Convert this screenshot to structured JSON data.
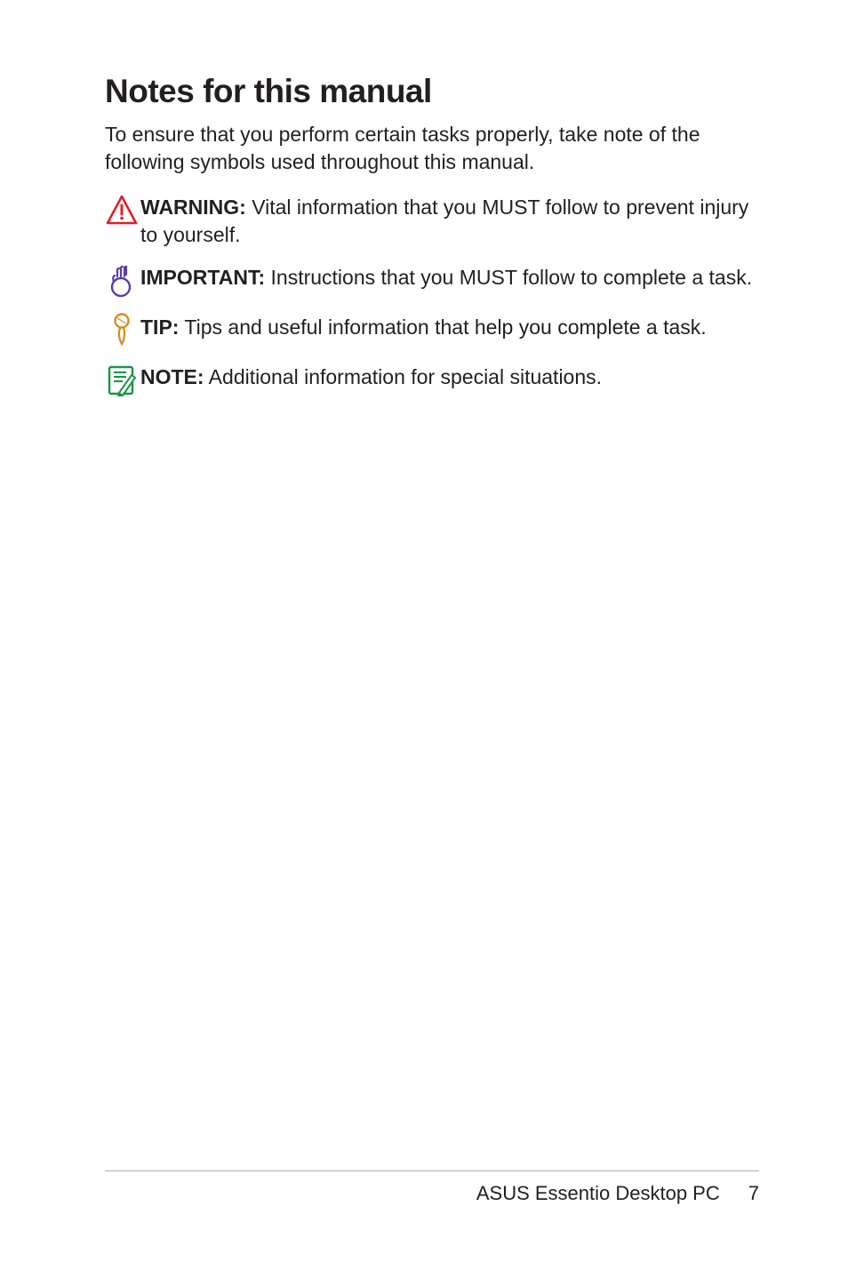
{
  "heading": "Notes for this manual",
  "intro": "To ensure that you perform certain tasks properly, take note of the following symbols used throughout this manual.",
  "notes": [
    {
      "label": "WARNING:",
      "body": " Vital information that you MUST follow to prevent injury to yourself."
    },
    {
      "label": "IMPORTANT:",
      "body": " Instructions that you MUST follow to complete a task."
    },
    {
      "label": "TIP:",
      "body": " Tips and useful information that help you complete a task."
    },
    {
      "label": "NOTE:",
      "body": " Additional information for special situations."
    }
  ],
  "footer": {
    "product": "ASUS Essentio Desktop PC",
    "page": "7"
  }
}
